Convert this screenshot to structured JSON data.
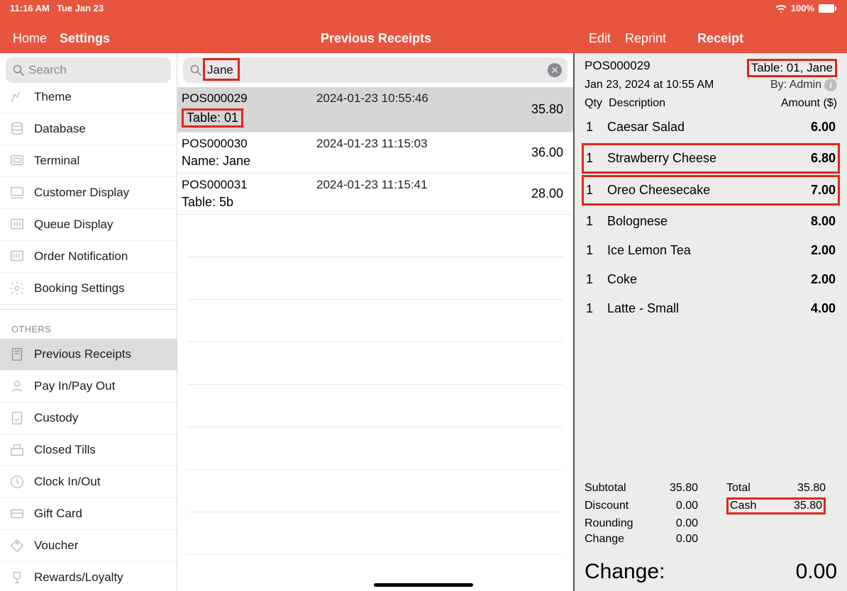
{
  "status": {
    "time": "11:16 AM",
    "date": "Tue Jan 23",
    "battery": "100%"
  },
  "header": {
    "home": "Home",
    "settings": "Settings",
    "title": "Previous Receipts",
    "edit": "Edit",
    "reprint": "Reprint",
    "receipt": "Receipt"
  },
  "sidebar": {
    "search_placeholder": "Search",
    "items_top": [
      {
        "label": "Theme"
      },
      {
        "label": "Database"
      },
      {
        "label": "Terminal"
      },
      {
        "label": "Customer Display"
      },
      {
        "label": "Queue Display"
      },
      {
        "label": "Order Notification"
      },
      {
        "label": "Booking Settings"
      }
    ],
    "section": "OTHERS",
    "items_others": [
      {
        "label": "Previous Receipts"
      },
      {
        "label": "Pay In/Pay Out"
      },
      {
        "label": "Custody"
      },
      {
        "label": "Closed Tills"
      },
      {
        "label": "Clock In/Out"
      },
      {
        "label": "Gift Card"
      },
      {
        "label": "Voucher"
      },
      {
        "label": "Rewards/Loyalty"
      }
    ]
  },
  "middle": {
    "search_value": "Jane",
    "receipts": [
      {
        "id": "POS000029",
        "date": "2024-01-23 10:55:46",
        "sub": "Table: 01",
        "amount": "35.80",
        "selected": true,
        "sub_boxed": true
      },
      {
        "id": "POS000030",
        "date": "2024-01-23 11:15:03",
        "sub": "Name: Jane",
        "amount": "36.00",
        "selected": false,
        "sub_boxed": false
      },
      {
        "id": "POS000031",
        "date": "2024-01-23 11:15:41",
        "sub": "Table: 5b",
        "amount": "28.00",
        "selected": false,
        "sub_boxed": false
      }
    ]
  },
  "receipt": {
    "id": "POS000029",
    "table": "Table: 01, Jane",
    "datetime": "Jan 23, 2024 at 10:55 AM",
    "by": "By: Admin",
    "cols": {
      "qty": "Qty",
      "desc": "Description",
      "amt": "Amount ($)"
    },
    "items": [
      {
        "qty": "1",
        "desc": "Caesar Salad",
        "amt": "6.00",
        "hl": false
      },
      {
        "qty": "1",
        "desc": "Strawberry Cheese",
        "amt": "6.80",
        "hl": true
      },
      {
        "qty": "1",
        "desc": "Oreo Cheesecake",
        "amt": "7.00",
        "hl": true
      },
      {
        "qty": "1",
        "desc": "Bolognese",
        "amt": "8.00",
        "hl": false
      },
      {
        "qty": "1",
        "desc": "Ice Lemon Tea",
        "amt": "2.00",
        "hl": false
      },
      {
        "qty": "1",
        "desc": "Coke",
        "amt": "2.00",
        "hl": false
      },
      {
        "qty": "1",
        "desc": "Latte - Small",
        "amt": "4.00",
        "hl": false
      }
    ],
    "totals": {
      "subtotal_label": "Subtotal",
      "subtotal": "35.80",
      "discount_label": "Discount",
      "discount": "0.00",
      "rounding_label": "Rounding",
      "rounding": "0.00",
      "change_label": "Change",
      "change_small": "0.00",
      "total_label": "Total",
      "total": "35.80",
      "cash_label": "Cash",
      "cash": "35.80"
    },
    "change_big_label": "Change:",
    "change_big": "0.00"
  }
}
